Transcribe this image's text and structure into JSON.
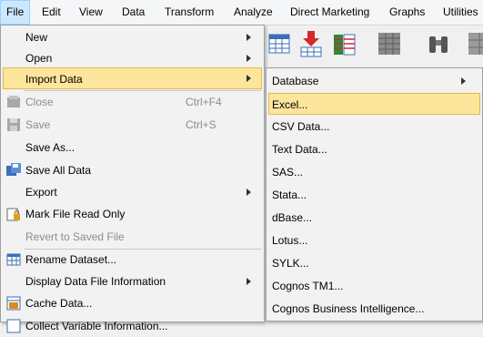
{
  "menubar": {
    "items": [
      "File",
      "Edit",
      "View",
      "Data",
      "Transform",
      "Analyze",
      "Direct Marketing",
      "Graphs",
      "Utilities"
    ]
  },
  "toolbar": {
    "icons": [
      "data-editor-icon",
      "goto-case-icon",
      "variables-icon",
      "find-icon",
      "binoculars-icon",
      "split-file-icon"
    ]
  },
  "file_menu": {
    "items": [
      {
        "label": "New",
        "shortcut": "",
        "submenu": true
      },
      {
        "label": "Open",
        "shortcut": "",
        "submenu": true
      },
      {
        "label": "Import Data",
        "shortcut": "",
        "submenu": true
      },
      {
        "label": "Close",
        "shortcut": "Ctrl+F4"
      },
      {
        "label": "Save",
        "shortcut": "Ctrl+S"
      },
      {
        "label": "Save As...",
        "shortcut": ""
      },
      {
        "label": "Save All Data",
        "shortcut": ""
      },
      {
        "label": "Export",
        "shortcut": "",
        "submenu": true
      },
      {
        "label": "Mark File Read Only",
        "shortcut": ""
      },
      {
        "label": "Revert to Saved File",
        "shortcut": ""
      },
      {
        "label": "Rename Dataset...",
        "shortcut": ""
      },
      {
        "label": "Display Data File Information",
        "shortcut": "",
        "submenu": true
      },
      {
        "label": "Cache Data...",
        "shortcut": ""
      },
      {
        "label": "Collect Variable Information...",
        "shortcut": ""
      }
    ]
  },
  "import_submenu": {
    "items": [
      "Database",
      "Excel...",
      "CSV Data...",
      "Text Data...",
      "SAS...",
      "Stata...",
      "dBase...",
      "Lotus...",
      "SYLK...",
      "Cognos TM1...",
      "Cognos Business Intelligence..."
    ]
  },
  "colors": {
    "highlight": "#fde59c",
    "highlight_border": "#e3b94f",
    "disabled": "#8c8c8c"
  }
}
